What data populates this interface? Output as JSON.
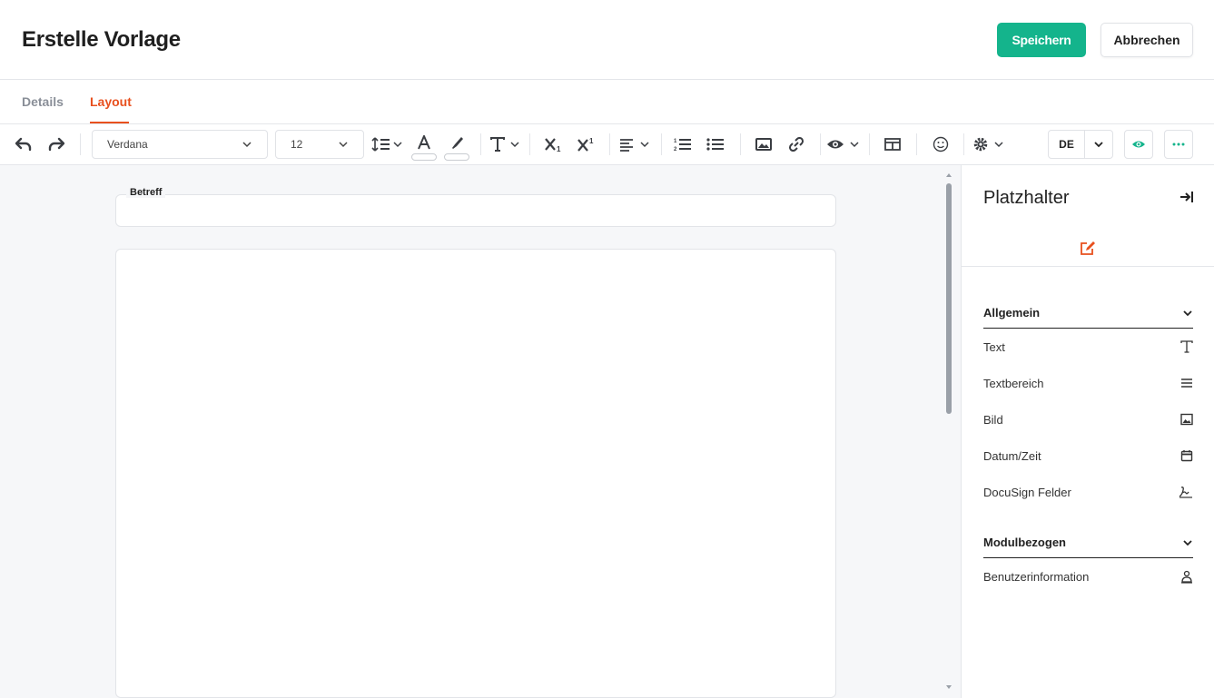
{
  "header": {
    "title": "Erstelle Vorlage",
    "save_label": "Speichern",
    "cancel_label": "Abbrechen"
  },
  "tabs": [
    {
      "label": "Details",
      "active": false
    },
    {
      "label": "Layout",
      "active": true
    }
  ],
  "toolbar": {
    "font_family": "Verdana",
    "font_size": "12",
    "language": "DE",
    "icons": [
      "undo-icon",
      "redo-icon",
      "line-height-icon",
      "font-color-icon",
      "highlight-icon",
      "text-format-icon",
      "subscript-icon",
      "superscript-icon",
      "align-icon",
      "ordered-list-icon",
      "unordered-list-icon",
      "image-icon",
      "link-icon",
      "preview-icon",
      "table-icon",
      "emoji-icon",
      "settings-icon",
      "eye-icon",
      "more-icon"
    ]
  },
  "editor": {
    "subject_label": "Betreff",
    "subject_value": ""
  },
  "panel": {
    "title": "Platzhalter",
    "sections": [
      {
        "label": "Allgemein",
        "items": [
          {
            "label": "Text",
            "icon": "text-icon"
          },
          {
            "label": "Textbereich",
            "icon": "textarea-icon"
          },
          {
            "label": "Bild",
            "icon": "image-icon"
          },
          {
            "label": "Datum/Zeit",
            "icon": "calendar-icon"
          },
          {
            "label": "DocuSign Felder",
            "icon": "signature-icon"
          }
        ]
      },
      {
        "label": "Modulbezogen",
        "items": [
          {
            "label": "Benutzerinformation",
            "icon": "user-icon"
          }
        ]
      }
    ]
  },
  "colors": {
    "accent": "#e8501e",
    "primary": "#14b48c"
  }
}
